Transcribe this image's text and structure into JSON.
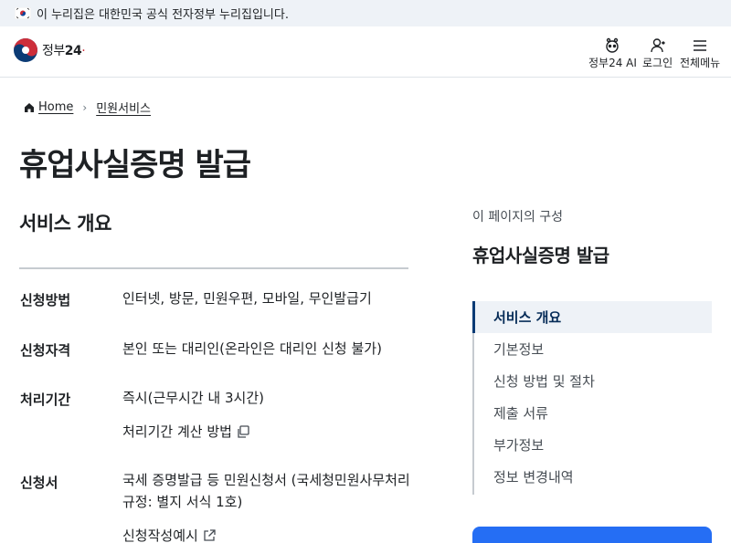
{
  "banner": {
    "text": "이 누리집은 대한민국 공식 전자정부 누리집입니다."
  },
  "header": {
    "logo_text": "정부",
    "logo_num": "24",
    "utils": [
      {
        "label": "정부24 AI",
        "icon": "ai-assistant-icon"
      },
      {
        "label": "로그인",
        "icon": "user-icon"
      },
      {
        "label": "전체메뉴",
        "icon": "hamburger-icon"
      }
    ]
  },
  "breadcrumb": {
    "home": "Home",
    "current": "민원서비스"
  },
  "page": {
    "title": "휴업사실증명 발급"
  },
  "overview": {
    "title": "서비스 개요",
    "rows": [
      {
        "label": "신청방법",
        "value": "인터넷, 방문, 민원우편, 모바일, 무인발급기"
      },
      {
        "label": "신청자격",
        "value": "본인 또는 대리인(온라인은 대리인 신청 불가)"
      },
      {
        "label": "처리기간",
        "value": "즉시(근무시간 내 3시간)",
        "link": "처리기간 계산 방법"
      },
      {
        "label": "신청서",
        "value": "국세 증명발급 등 민원신청서 (국세청민원사무처리규정: 별지 서식 1호)",
        "link": "신청작성예시"
      }
    ]
  },
  "toc": {
    "caption": "이 페이지의 구성",
    "title": "휴업사실증명 발급",
    "items": [
      "서비스 개요",
      "기본정보",
      "신청 방법 및 절차",
      "제출 서류",
      "부가정보",
      "정보 변경내역"
    ],
    "active_index": 0
  },
  "colors": {
    "accent": "#256ef4",
    "navy": "#052b57",
    "banner_bg": "#eef2f7"
  }
}
